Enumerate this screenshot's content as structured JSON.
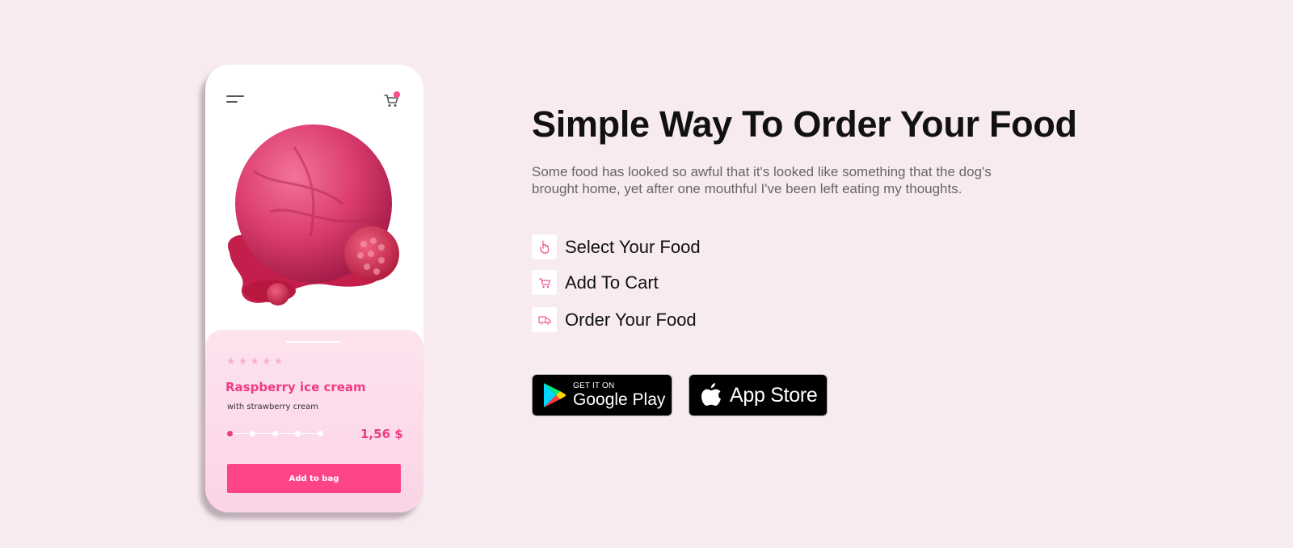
{
  "phone": {
    "product_name": "Raspberry ice cream",
    "product_subtitle": "with strawberry cream",
    "price": "1,56 $",
    "add_button_label": "Add to bag",
    "rating_stars": 5,
    "size_options_count": 5,
    "selected_size_index": 0,
    "cart_has_badge": true
  },
  "main": {
    "headline": "Simple Way To Order Your Food",
    "description": "Some food has looked so awful that it's looked like something that the dog's brought home, yet after one mouthful I've been left eating my thoughts.",
    "steps": [
      {
        "icon": "hand-tap-icon",
        "label": "Select Your Food"
      },
      {
        "icon": "cart-icon",
        "label": "Add To Cart"
      },
      {
        "icon": "delivery-icon",
        "label": "Order Your Food"
      }
    ]
  },
  "stores": {
    "google_play_small": "GET IT ON",
    "google_play_big": "Google Play",
    "app_store_big": "App Store"
  },
  "colors": {
    "background": "#f7ebf0",
    "accent": "#ee3d84",
    "button": "#fe4489"
  }
}
